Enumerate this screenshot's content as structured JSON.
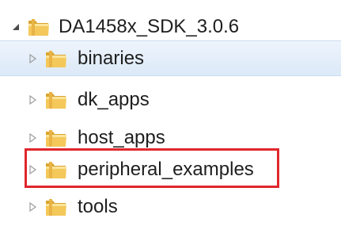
{
  "tree": {
    "root": {
      "label": "DA1458x_SDK_3.0.6",
      "expanded": true,
      "icon": "folder-icon"
    },
    "children": [
      {
        "label": "binaries",
        "selected": true,
        "icon": "folder-icon"
      },
      {
        "label": "dk_apps",
        "selected": false,
        "icon": "folder-icon"
      },
      {
        "label": "host_apps",
        "selected": false,
        "icon": "folder-icon"
      },
      {
        "label": "peripheral_examples",
        "selected": false,
        "highlighted": true,
        "icon": "folder-icon"
      },
      {
        "label": "tools",
        "selected": false,
        "icon": "folder-icon"
      }
    ]
  },
  "colors": {
    "selection_bg": "#dce9f8",
    "selection_border": "#cbdcf1",
    "highlight_border": "#e0262b",
    "folder_body": "#f4c85a",
    "folder_dark": "#d9a530"
  }
}
